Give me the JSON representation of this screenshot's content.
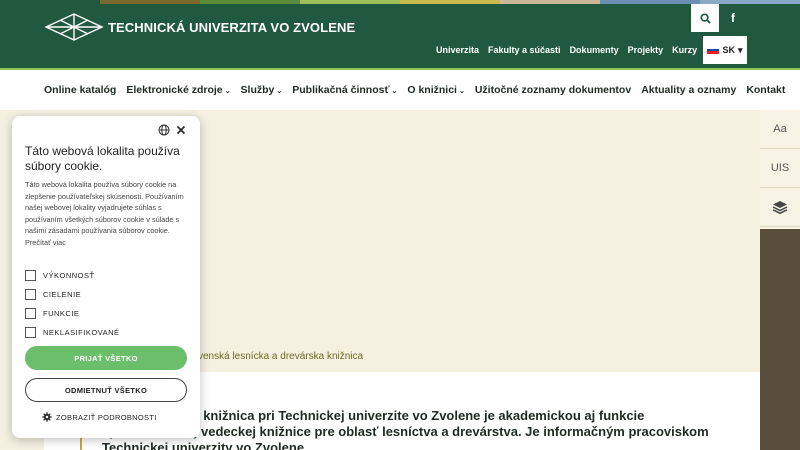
{
  "colors": {
    "header_bg": "#21593f",
    "accent_green": "#8bc25a",
    "cookie_accept": "#6cbf6a",
    "strip": [
      "#21593f",
      "#7a6a2e",
      "#5b8a3a",
      "#9bbf5a",
      "#c9b94f",
      "#cbb89a",
      "#6b8fb0",
      "#8aa9c9"
    ]
  },
  "header": {
    "logo_text": "TECHNICKÁ UNIVERZITA VO ZVOLENE",
    "top_links": [
      "Univerzita",
      "Fakulty a súčasti",
      "Dokumenty",
      "Projekty",
      "Kurzy"
    ],
    "search_icon": "search-icon",
    "facebook_label": "f",
    "lang_label": "SK"
  },
  "nav": {
    "items": [
      {
        "label": "Online katalóg",
        "caret": ""
      },
      {
        "label": "Elektronické zdroje",
        "caret": "⌄"
      },
      {
        "label": "Služby",
        "caret": "⌄"
      },
      {
        "label": "Publikačná činnosť",
        "caret": "⌄"
      },
      {
        "label": "O knižnici",
        "caret": "⌄"
      },
      {
        "label": "Užitočné zoznamy dokumentov",
        "caret": ""
      },
      {
        "label": "Aktuality a oznamy",
        "caret": ""
      },
      {
        "label": "Kontakt",
        "caret": ""
      }
    ]
  },
  "side_tools": {
    "font_size_label": "Aa",
    "uis_label": "UIS"
  },
  "breadcrumb": "venská lesnícka a drevárska knižnica",
  "content": {
    "intro": "cka a drevárska knižnica pri Technickej univerzite vo Zvolene je akademickou aj funkcie špecializovanej vedeckej knižnice pre oblasť lesníctva a drevárstva. Je informačným pracoviskom Technickej univerzity vo Zvolene."
  },
  "cookie": {
    "title": "Táto webová lokalita používa súbory cookie.",
    "text": "Táto webová lokalita používa súbory cookie na zlepšenie používateľskej skúsenosti. Používaním našej webovej lokality vyjadrujete súhlas s používaním všetkých súborov cookie v súlade s našimi zásadami používania súborov cookie. Prečítať viac",
    "options": [
      "VÝKONNOSŤ",
      "CIELENIE",
      "FUNKCIE",
      "NEKLASIFIKOVANÉ"
    ],
    "accept_label": "PRIJAŤ VŠETKO",
    "decline_label": "ODMIETNUŤ VŠETKO",
    "details_label": "ZOBRAZIŤ PODROBNOSTI"
  }
}
